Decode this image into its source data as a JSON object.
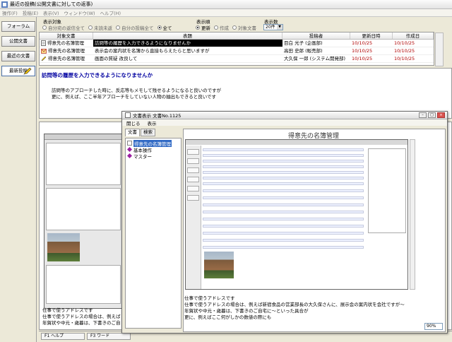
{
  "window": {
    "title": "最近の投稿(公開文書に対しての返事)"
  },
  "menu": [
    "操作(F)",
    "投稿(E)",
    "表示(V)",
    "ウィンドウ(W)",
    "ヘルプ(H)"
  ],
  "nav": {
    "items": [
      "フォーラム",
      "公開文書",
      "最近の文書",
      "最新投稿"
    ]
  },
  "filters": {
    "target_label": "表示対象",
    "target_options": [
      "自分宛の返信全て",
      "未読未返",
      "自分の投稿全て",
      "全て"
    ],
    "target_selected": "全て",
    "order_label": "表示順",
    "order_options": [
      "更新",
      "作成",
      "対象文書"
    ],
    "order_selected": "更新",
    "count_label": "表示数",
    "count_value": "20件"
  },
  "table": {
    "headers": [
      "対象文書",
      "表題",
      "投稿者",
      "更新日時",
      "作成日"
    ],
    "rows": [
      {
        "doc": "得意先の名簿管理",
        "title": "訪問等の履歴を入力できるようになりませんか",
        "author": "目白 光子 (企画部)",
        "updated": "10/10/25",
        "created": "10/10/25",
        "selected": true
      },
      {
        "doc": "得意先の名簿管理",
        "title": "表示会の案内状を名簿から直接もらえたらと思いますが",
        "author": "高田 史郎 (販売部)",
        "updated": "10/10/25",
        "created": "10/10/25",
        "selected": false
      },
      {
        "doc": "得意先の名簿管理",
        "title": "画面の質疑 改良して",
        "author": "大久保 一郎 (システム開発部)",
        "updated": "10/10/25",
        "created": "10/10/25",
        "selected": false
      }
    ]
  },
  "detail": {
    "subject": "訪問等の履歴を入力できるようになりませんか",
    "body_line1": "訪問等のアプローチした時に、反応等もメモして残せるようになると良いのですが",
    "body_line2": "更に、例えば、ここ半年アプローチをしていない人物の抽出もできると良いです"
  },
  "lower": {
    "text_line1": "仕事で使うアドレスです",
    "text_line2": "仕事で使うアドレスの場合は、例えば",
    "text_line3": "年賀状や中元・歳暮は、下書きのご自"
  },
  "statusbar": {
    "f1": "F1 ヘルプ",
    "f3": "F3 ワード"
  },
  "dialog": {
    "title": "文書表示 文書No.1125",
    "menu": [
      "開じる",
      "表示"
    ],
    "tab_doc": "文書",
    "tab_search": "検索",
    "tree": [
      "得意先の名簿管理",
      "基本操作",
      "マスター"
    ],
    "doc_heading": "得意先の名簿管理",
    "text_line1": "仕事で使うアドレスです",
    "text_line2": "仕事で使うアドレスの場合は、例えば新宿食品の営業部長の大久保さんに、展示会の案内状を会社ですが～",
    "text_line3": "年賀状や中元・歳暮は、下書きのご自宅に～といった具合が",
    "text_line4": "更に、例えばここ何がしかの数値の際にも",
    "zoom": "90%"
  }
}
